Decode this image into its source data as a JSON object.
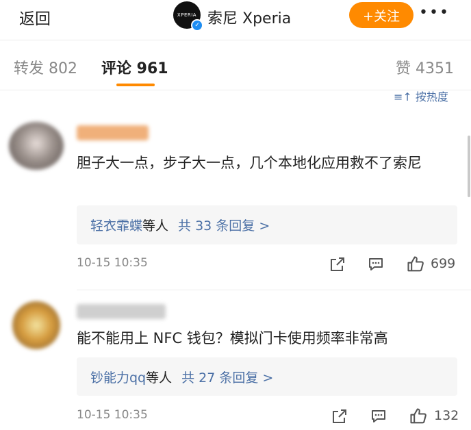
{
  "header": {
    "back_label": "返回",
    "logo_text": "XPERIA",
    "account_name": "索尼 Xperia",
    "follow_label": "+关注",
    "more_label": "•••"
  },
  "tabs": {
    "repost": "转发 802",
    "comments": "评论 961",
    "likes": "赞 4351",
    "sort_label": "≡↑ 按热度"
  },
  "comments": [
    {
      "username": "",
      "text": "胆子大一点，步子大一点，几个本地化应用救不了索尼",
      "reply_user": "轻衣霏蝶",
      "reply_suffix": "等人",
      "reply_count": "共 33 条回复 >",
      "time": "10-15 10:35",
      "likes": "699"
    },
    {
      "username": "",
      "text": "能不能用上 NFC 钱包？模拟门卡使用频率非常高",
      "reply_user": "钞能力qq",
      "reply_suffix": "等人",
      "reply_count": "共 27 条回复 >",
      "time": "10-15 10:35",
      "likes": "132"
    }
  ],
  "icons": {
    "share": "share-icon",
    "comment": "comment-icon",
    "like": "thumbs-up-icon"
  },
  "colors": {
    "accent": "#ff8a00",
    "link": "#4a6fa5"
  }
}
